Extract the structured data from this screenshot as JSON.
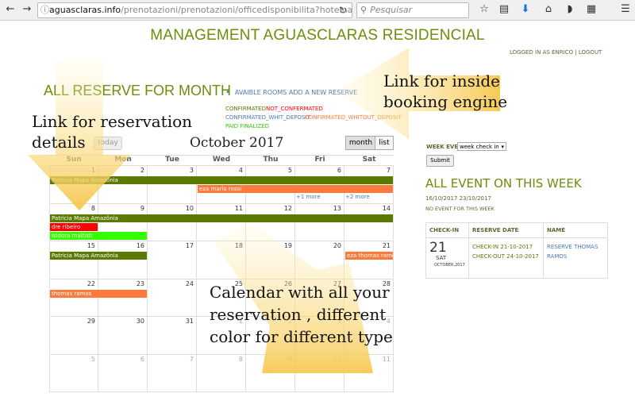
{
  "browser": {
    "url_host": "aguasclaras.info",
    "url_path": "/prenotazioni/prenotazioni/officedisponibilita?hotelnature_ge",
    "search_placeholder": "Pesquisar"
  },
  "header": {
    "title": "MANAGEMENT AGUASCLARAS RESIDENCIAL",
    "logged_in": "LOGGED IN AS ENRICO",
    "separator": "|",
    "logout": "LOGOUT"
  },
  "main": {
    "heading": "ALL RESERVE FOR MONTH",
    "avail_link": "AVAIBLE ROOMS ADD A NEW RESERVE",
    "legend": {
      "confirmed": "CONFIRMATED",
      "not_confirmed": "NOT_CONFERMATED",
      "with_deposit": "CONFIRMATED_WHIT_DEPOSIT",
      "without_deposit": "CONFIRMATED_WHITOUT_DEPOSIT",
      "paid": "PAID FINALIZED"
    },
    "legend_colors": {
      "confirmed": "#5a7a00",
      "not_confirmed": "#ff0000",
      "with_deposit": "#4a7ab5",
      "without_deposit": "#ff7a3a",
      "paid": "#33cc00"
    }
  },
  "calendar": {
    "today_label": "today",
    "title": "October 2017",
    "month_label": "month",
    "list_label": "list",
    "days": [
      "Sun",
      "Mon",
      "Tue",
      "Wed",
      "Thu",
      "Fri",
      "Sat"
    ],
    "weeks": [
      [
        [
          "1",
          false
        ],
        [
          "2",
          false
        ],
        [
          "3",
          false
        ],
        [
          "4",
          false
        ],
        [
          "5",
          false
        ],
        [
          "6",
          false
        ],
        [
          "7",
          false
        ]
      ],
      [
        [
          "8",
          false
        ],
        [
          "9",
          false
        ],
        [
          "10",
          false
        ],
        [
          "11",
          false
        ],
        [
          "12",
          false
        ],
        [
          "13",
          false
        ],
        [
          "14",
          false
        ]
      ],
      [
        [
          "15",
          false
        ],
        [
          "16",
          false
        ],
        [
          "17",
          false
        ],
        [
          "18",
          false
        ],
        [
          "19",
          false
        ],
        [
          "20",
          false
        ],
        [
          "21",
          false
        ]
      ],
      [
        [
          "22",
          false
        ],
        [
          "23",
          false
        ],
        [
          "24",
          false
        ],
        [
          "25",
          false
        ],
        [
          "26",
          false
        ],
        [
          "27",
          false
        ],
        [
          "28",
          false
        ]
      ],
      [
        [
          "29",
          false
        ],
        [
          "30",
          false
        ],
        [
          "31",
          false
        ],
        [
          "1",
          true
        ],
        [
          "2",
          true
        ],
        [
          "3",
          true
        ],
        [
          "4",
          true
        ]
      ],
      [
        [
          "5",
          true
        ],
        [
          "6",
          true
        ],
        [
          "7",
          true
        ],
        [
          "8",
          true
        ],
        [
          "9",
          true
        ],
        [
          "10",
          true
        ],
        [
          "11",
          true
        ]
      ]
    ],
    "events": [
      {
        "week": 0,
        "start": 0,
        "span": 7,
        "row": 0,
        "label": "Patricia Mapa Amazônia",
        "color": "#5a7a00"
      },
      {
        "week": 0,
        "start": 3,
        "span": 4,
        "row": 1,
        "label": "eza mario rossi",
        "color": "#ff7a3a"
      },
      {
        "week": 1,
        "start": 0,
        "span": 7,
        "row": 0,
        "label": "Patricia Mapa Amazônia",
        "color": "#5a7a00"
      },
      {
        "week": 1,
        "start": 0,
        "span": 1,
        "row": 1,
        "label": "dre ribeiro",
        "color": "#ff0000"
      },
      {
        "week": 1,
        "start": 0,
        "span": 2,
        "row": 2,
        "label": "isidora maltisti",
        "color": "#33ff00"
      },
      {
        "week": 2,
        "start": 0,
        "span": 2,
        "row": 0,
        "label": "Patricia Mapa Amazônia",
        "color": "#5a7a00"
      },
      {
        "week": 2,
        "start": 6,
        "span": 1,
        "row": 0,
        "label": "eza thomas ramo",
        "color": "#ff7a3a"
      },
      {
        "week": 3,
        "start": 0,
        "span": 2,
        "row": 0,
        "label": "thomas ramos",
        "color": "#ff7a3a"
      }
    ],
    "more_links": [
      {
        "week": 0,
        "col": 5,
        "label": "+1 more"
      },
      {
        "week": 0,
        "col": 6,
        "label": "+2 more"
      }
    ]
  },
  "sidebar": {
    "week_event_label": "WEEK EVENT",
    "week_event_value": "week check in",
    "submit_label": "Submit",
    "heading": "ALL EVENT ON THIS WEEK",
    "date_range": "16/10/2017 23/10/2017",
    "no_event": "NO EVENT FOR THIS WEEK",
    "table": {
      "headers": [
        "CHECK-IN",
        "RESERVE DATE",
        "NAME"
      ],
      "day": "21",
      "weekday": "SAT",
      "month": "OCTOBER,2017",
      "checkin": "CHECK-IN 21-10-2017",
      "checkout": "CHECK-OUT 24-10-2017",
      "name_line1": "RESERVE THOMAS",
      "name_line2": "RAMOS"
    }
  },
  "annotations": {
    "booking_engine": "Link for inside booking  engine",
    "booking_engine_l1": "Link for inside",
    "booking_engine_l2": "booking  engine",
    "reservation_details_l1": "Link for reservation",
    "reservation_details_l2": "details",
    "calendar_l1": "Calendar with all your",
    "calendar_l2": "reservation , different",
    "calendar_l3": "color for different type"
  }
}
